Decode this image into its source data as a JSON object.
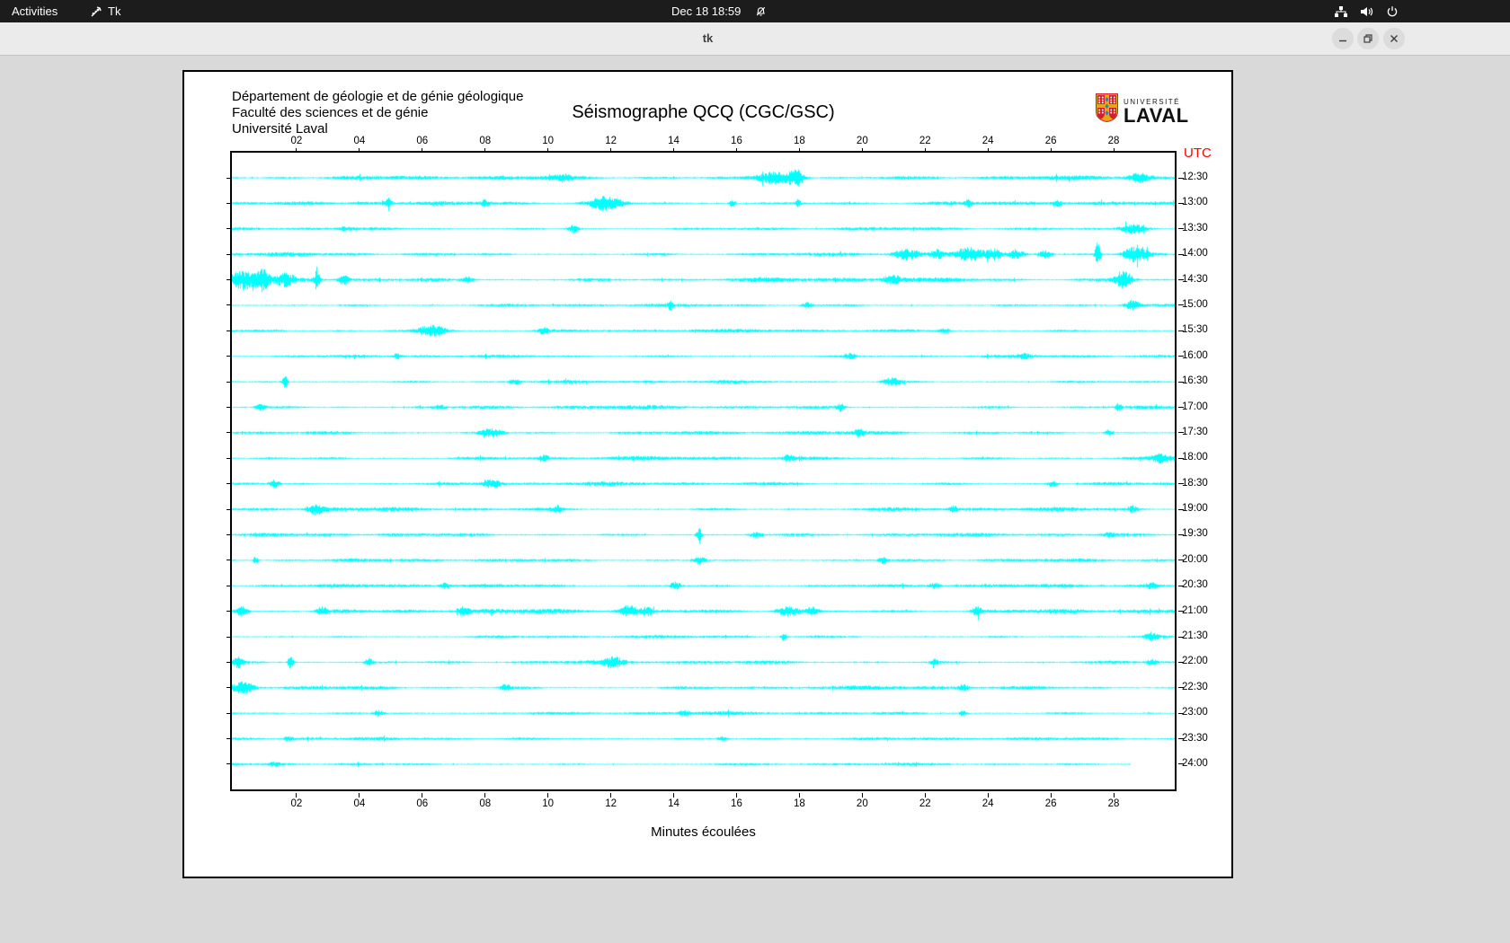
{
  "top_bar": {
    "activities": "Activities",
    "app_name": "Tk",
    "clock": "Dec 18  18:59"
  },
  "window": {
    "title": "tk",
    "buttons": {
      "minimize": "minimize",
      "maximize": "maximize",
      "close": "close"
    }
  },
  "canvas": {
    "header_lines": [
      "Département de géologie et de génie géologique",
      "Faculté des sciences et de génie",
      "Université Laval"
    ],
    "title": "Séismographe QCQ (CGC/GSC)",
    "logo": {
      "small_text": "UNIVERSITÉ",
      "large_text": "LAVAL"
    },
    "utc_label": "UTC",
    "xlabel": "Minutes écoulées"
  },
  "colors": {
    "trace": "#00ffff",
    "utc": "#ff0000",
    "logo_red": "#d0202e",
    "logo_gold": "#e7a614",
    "logo_blue": "#2f7ec7"
  },
  "chart_data": {
    "type": "line",
    "subtype": "seismogram-helicorder",
    "title": "Séismographe QCQ (CGC/GSC)",
    "xlabel": "Minutes écoulées",
    "x_range": [
      0,
      30
    ],
    "x_ticks": [
      "02",
      "04",
      "06",
      "08",
      "10",
      "12",
      "14",
      "16",
      "18",
      "20",
      "22",
      "24",
      "26",
      "28"
    ],
    "y_axis_label": "UTC",
    "minutes_per_row": 30,
    "traces": [
      {
        "label": "12:30",
        "seed": 1,
        "base": 2.1,
        "len": 1,
        "bursts": [
          [
            0.575,
            6,
            14
          ],
          [
            0.598,
            8,
            6
          ],
          [
            0.35,
            3,
            6
          ],
          [
            0.962,
            4,
            8
          ]
        ]
      },
      {
        "label": "13:00",
        "seed": 2,
        "base": 1.9,
        "len": 1,
        "bursts": [
          [
            0.165,
            4,
            3
          ],
          [
            0.397,
            7,
            12
          ],
          [
            0.53,
            4,
            2
          ],
          [
            0.6,
            4,
            2
          ],
          [
            0.268,
            3,
            3
          ],
          [
            0.78,
            3,
            3
          ],
          [
            0.875,
            3,
            4
          ]
        ]
      },
      {
        "label": "13:30",
        "seed": 3,
        "base": 1.6,
        "len": 1,
        "bursts": [
          [
            0.362,
            4,
            4
          ],
          [
            0.955,
            5,
            10
          ],
          [
            0.12,
            2,
            5
          ]
        ]
      },
      {
        "label": "14:00",
        "seed": 4,
        "base": 1.8,
        "len": 1,
        "bursts": [
          [
            0.715,
            5,
            9
          ],
          [
            0.748,
            4,
            5
          ],
          [
            0.782,
            7,
            10
          ],
          [
            0.808,
            5,
            5
          ],
          [
            0.832,
            4,
            5
          ],
          [
            0.862,
            4,
            5
          ],
          [
            0.918,
            14,
            2
          ],
          [
            0.958,
            8,
            9
          ]
        ]
      },
      {
        "label": "14:30",
        "seed": 5,
        "base": 2.3,
        "len": 1,
        "bursts": [
          [
            0.012,
            8,
            9
          ],
          [
            0.032,
            11,
            5
          ],
          [
            0.056,
            6,
            7
          ],
          [
            0.09,
            13,
            2
          ],
          [
            0.118,
            5,
            4
          ],
          [
            0.25,
            3,
            5
          ],
          [
            0.7,
            4,
            7
          ],
          [
            0.945,
            9,
            7
          ]
        ]
      },
      {
        "label": "15:00",
        "seed": 6,
        "base": 1.5,
        "len": 1,
        "bursts": [
          [
            0.465,
            4,
            2
          ],
          [
            0.61,
            3,
            4
          ],
          [
            0.955,
            5,
            6
          ]
        ]
      },
      {
        "label": "15:30",
        "seed": 7,
        "base": 1.7,
        "len": 1,
        "bursts": [
          [
            0.212,
            6,
            11
          ],
          [
            0.33,
            3,
            4
          ],
          [
            0.755,
            3,
            4
          ]
        ]
      },
      {
        "label": "16:00",
        "seed": 8,
        "base": 1.5,
        "len": 1,
        "bursts": [
          [
            0.175,
            3,
            3
          ],
          [
            0.655,
            3,
            4
          ],
          [
            0.84,
            2,
            5
          ]
        ]
      },
      {
        "label": "16:30",
        "seed": 9,
        "base": 1.6,
        "len": 1,
        "bursts": [
          [
            0.056,
            6,
            2
          ],
          [
            0.3,
            3,
            4
          ],
          [
            0.7,
            4,
            7
          ]
        ]
      },
      {
        "label": "17:00",
        "seed": 10,
        "base": 1.9,
        "len": 1,
        "bursts": [
          [
            0.03,
            3,
            4
          ],
          [
            0.645,
            4,
            3
          ],
          [
            0.94,
            4,
            2
          ],
          [
            0.22,
            2,
            4
          ]
        ]
      },
      {
        "label": "17:30",
        "seed": 11,
        "base": 1.8,
        "len": 1,
        "bursts": [
          [
            0.275,
            4,
            9
          ],
          [
            0.665,
            3,
            4
          ],
          [
            0.93,
            3,
            3
          ]
        ]
      },
      {
        "label": "18:00",
        "seed": 12,
        "base": 1.9,
        "len": 1,
        "bursts": [
          [
            0.33,
            3,
            4
          ],
          [
            0.59,
            3,
            4
          ],
          [
            0.985,
            4,
            7
          ]
        ]
      },
      {
        "label": "18:30",
        "seed": 13,
        "base": 1.9,
        "len": 1,
        "bursts": [
          [
            0.045,
            4,
            4
          ],
          [
            0.275,
            4,
            8
          ],
          [
            0.87,
            3,
            4
          ]
        ]
      },
      {
        "label": "19:00",
        "seed": 14,
        "base": 1.9,
        "len": 1,
        "bursts": [
          [
            0.09,
            5,
            7
          ],
          [
            0.345,
            3,
            4
          ],
          [
            0.765,
            3,
            3
          ],
          [
            0.955,
            3,
            4
          ]
        ]
      },
      {
        "label": "19:30",
        "seed": 15,
        "base": 1.7,
        "len": 1,
        "bursts": [
          [
            0.495,
            8,
            2
          ],
          [
            0.556,
            3,
            5
          ],
          [
            0.93,
            2,
            4
          ]
        ]
      },
      {
        "label": "20:00",
        "seed": 16,
        "base": 1.6,
        "len": 1,
        "bursts": [
          [
            0.025,
            4,
            2
          ],
          [
            0.495,
            4,
            5
          ],
          [
            0.69,
            3,
            3
          ]
        ]
      },
      {
        "label": "20:30",
        "seed": 17,
        "base": 1.8,
        "len": 1,
        "bursts": [
          [
            0.225,
            3,
            4
          ],
          [
            0.47,
            4,
            4
          ],
          [
            0.745,
            3,
            4
          ],
          [
            0.975,
            3,
            5
          ]
        ]
      },
      {
        "label": "21:00",
        "seed": 18,
        "base": 2.3,
        "len": 1,
        "bursts": [
          [
            0.01,
            5,
            5
          ],
          [
            0.095,
            4,
            4
          ],
          [
            0.245,
            4,
            4
          ],
          [
            0.42,
            5,
            7
          ],
          [
            0.44,
            4,
            4
          ],
          [
            0.59,
            5,
            9
          ],
          [
            0.615,
            4,
            5
          ],
          [
            0.79,
            4,
            4
          ]
        ]
      },
      {
        "label": "21:30",
        "seed": 19,
        "base": 1.5,
        "len": 1,
        "bursts": [
          [
            0.585,
            4,
            2
          ],
          [
            0.975,
            4,
            5
          ]
        ]
      },
      {
        "label": "22:00",
        "seed": 20,
        "base": 1.8,
        "len": 1,
        "bursts": [
          [
            0.006,
            5,
            4
          ],
          [
            0.062,
            8,
            2
          ],
          [
            0.145,
            4,
            3
          ],
          [
            0.405,
            5,
            7
          ],
          [
            0.745,
            3,
            3
          ],
          [
            0.975,
            3,
            4
          ]
        ]
      },
      {
        "label": "22:30",
        "seed": 21,
        "base": 1.9,
        "len": 1,
        "bursts": [
          [
            0.012,
            6,
            7
          ],
          [
            0.29,
            3,
            4
          ],
          [
            0.775,
            3,
            4
          ]
        ]
      },
      {
        "label": "23:00",
        "seed": 22,
        "base": 1.7,
        "len": 1,
        "bursts": [
          [
            0.155,
            3,
            4
          ],
          [
            0.775,
            3,
            3
          ],
          [
            0.48,
            2,
            5
          ]
        ]
      },
      {
        "label": "23:30",
        "seed": 23,
        "base": 1.5,
        "len": 1,
        "bursts": [
          [
            0.06,
            2,
            4
          ],
          [
            0.52,
            2,
            4
          ]
        ]
      },
      {
        "label": "24:00",
        "seed": 24,
        "base": 1.35,
        "len": 0.953,
        "bursts": [
          [
            0.045,
            2,
            4
          ]
        ]
      }
    ]
  }
}
